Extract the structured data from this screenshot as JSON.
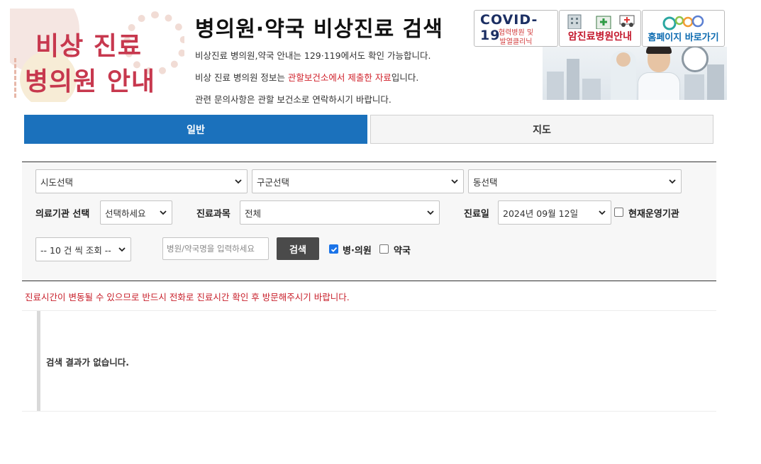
{
  "logo": {
    "line1": "비상 진료",
    "line2": "병의원 안내"
  },
  "header": {
    "title": "병의원·약국 비상진료 검색",
    "info1": "비상진료 병의원,약국 안내는 129·119에서도 확인 가능합니다.",
    "info2_prefix": "비상 진료 병의원 정보는 ",
    "info2_highlight": "관할보건소에서 제출한 자료",
    "info2_suffix": "입니다.",
    "info3": "관련 문의사항은 관할 보건소로 연락하시기 바랍니다."
  },
  "banners": {
    "covid_title": "COVID-19",
    "covid_sub1": "협력병원 및",
    "covid_sub2": "발열클리닉",
    "cancer_label": "암진료병원안내",
    "home_label": "홈페이지 바로가기"
  },
  "tabs": [
    {
      "label": "일반",
      "active": true
    },
    {
      "label": "지도",
      "active": false
    }
  ],
  "filters": {
    "sido": "시도선택",
    "gugun": "구군선택",
    "dong": "동선택",
    "org_label": "의료기관 선택",
    "org_value": "선택하세요",
    "dept_label": "진료과목",
    "dept_value": "전체",
    "date_label": "진료일",
    "date_value": "2024년 09월 12일",
    "open_now_label": "현재운영기관",
    "open_now_checked": false,
    "page_size": "-- 10 건 씩 조회 --",
    "name_placeholder": "병원/약국명을 입력하세요",
    "search_button": "검색",
    "hospital_label": "병·의원",
    "hospital_checked": true,
    "pharmacy_label": "약국",
    "pharmacy_checked": false
  },
  "notice": "진료시간이 변동될 수 있으므로 반드시 전화로 진료시간 확인 후 방문해주시기 바랍니다.",
  "results": {
    "empty_message": "검색 결과가 없습니다."
  },
  "colors": {
    "accent": "#1b71bc",
    "warning": "#c8202b",
    "logo": "#c7384e"
  }
}
